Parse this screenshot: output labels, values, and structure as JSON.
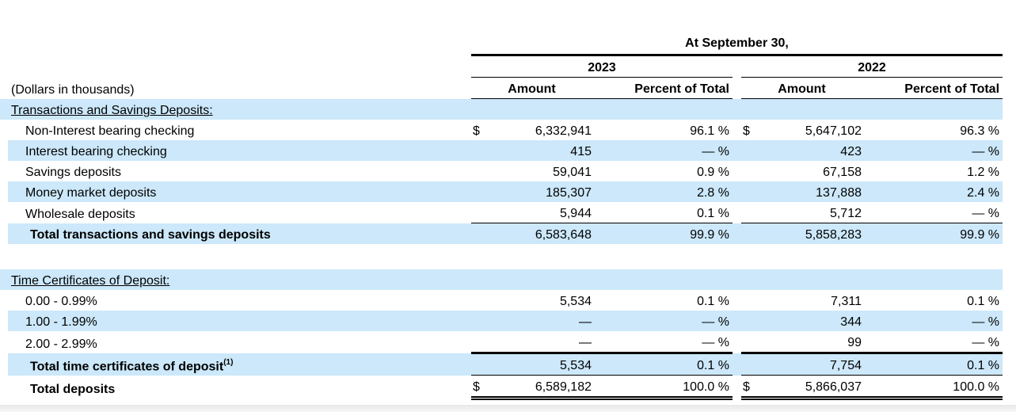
{
  "page": {
    "row_highlight_color": "#cce8fa",
    "text_color": "#000000",
    "background_color": "#ffffff"
  },
  "table": {
    "period_header": "At September 30,",
    "units_note": "(Dollars in thousands)",
    "columns": {
      "year_2023": "2023",
      "year_2022": "2022",
      "amount": "Amount",
      "percent": "Percent of Total"
    },
    "section1": {
      "title": "Transactions and Savings Deposits:",
      "rows": [
        {
          "label": "Non-Interest bearing checking",
          "dollar_2023": "$",
          "amount_2023": "6,332,941",
          "pct_2023": "96.1 %",
          "dollar_2022": "$",
          "amount_2022": "5,647,102",
          "pct_2022": "96.3 %"
        },
        {
          "label": "Interest bearing checking",
          "amount_2023": "415",
          "pct_2023": "— %",
          "amount_2022": "423",
          "pct_2022": "— %"
        },
        {
          "label": "Savings deposits",
          "amount_2023": "59,041",
          "pct_2023": "0.9 %",
          "amount_2022": "67,158",
          "pct_2022": "1.2 %"
        },
        {
          "label": "Money market deposits",
          "amount_2023": "185,307",
          "pct_2023": "2.8 %",
          "amount_2022": "137,888",
          "pct_2022": "2.4 %"
        },
        {
          "label": "Wholesale deposits",
          "amount_2023": "5,944",
          "pct_2023": "0.1 %",
          "amount_2022": "5,712",
          "pct_2022": "— %"
        }
      ],
      "total": {
        "label": "Total transactions and savings deposits",
        "amount_2023": "6,583,648",
        "pct_2023": "99.9 %",
        "amount_2022": "5,858,283",
        "pct_2022": "99.9 %"
      }
    },
    "section2": {
      "title": "Time Certificates of Deposit:",
      "rows": [
        {
          "label": "0.00 - 0.99%",
          "amount_2023": "5,534",
          "pct_2023": "0.1 %",
          "amount_2022": "7,311",
          "pct_2022": "0.1 %"
        },
        {
          "label": "1.00 - 1.99%",
          "amount_2023": "—",
          "pct_2023": "— %",
          "amount_2022": "344",
          "pct_2022": "— %"
        },
        {
          "label": "2.00 - 2.99%",
          "amount_2023": "—",
          "pct_2023": "— %",
          "amount_2022": "99",
          "pct_2022": "— %"
        }
      ],
      "total": {
        "label": "Total time certificates of deposit",
        "footnote": "(1)",
        "amount_2023": "5,534",
        "pct_2023": "0.1 %",
        "amount_2022": "7,754",
        "pct_2022": "0.1 %"
      }
    },
    "grand_total": {
      "label": "Total deposits",
      "dollar_2023": "$",
      "amount_2023": "6,589,182",
      "pct_2023": "100.0 %",
      "dollar_2022": "$",
      "amount_2022": "5,866,037",
      "pct_2022": "100.0 %"
    }
  }
}
